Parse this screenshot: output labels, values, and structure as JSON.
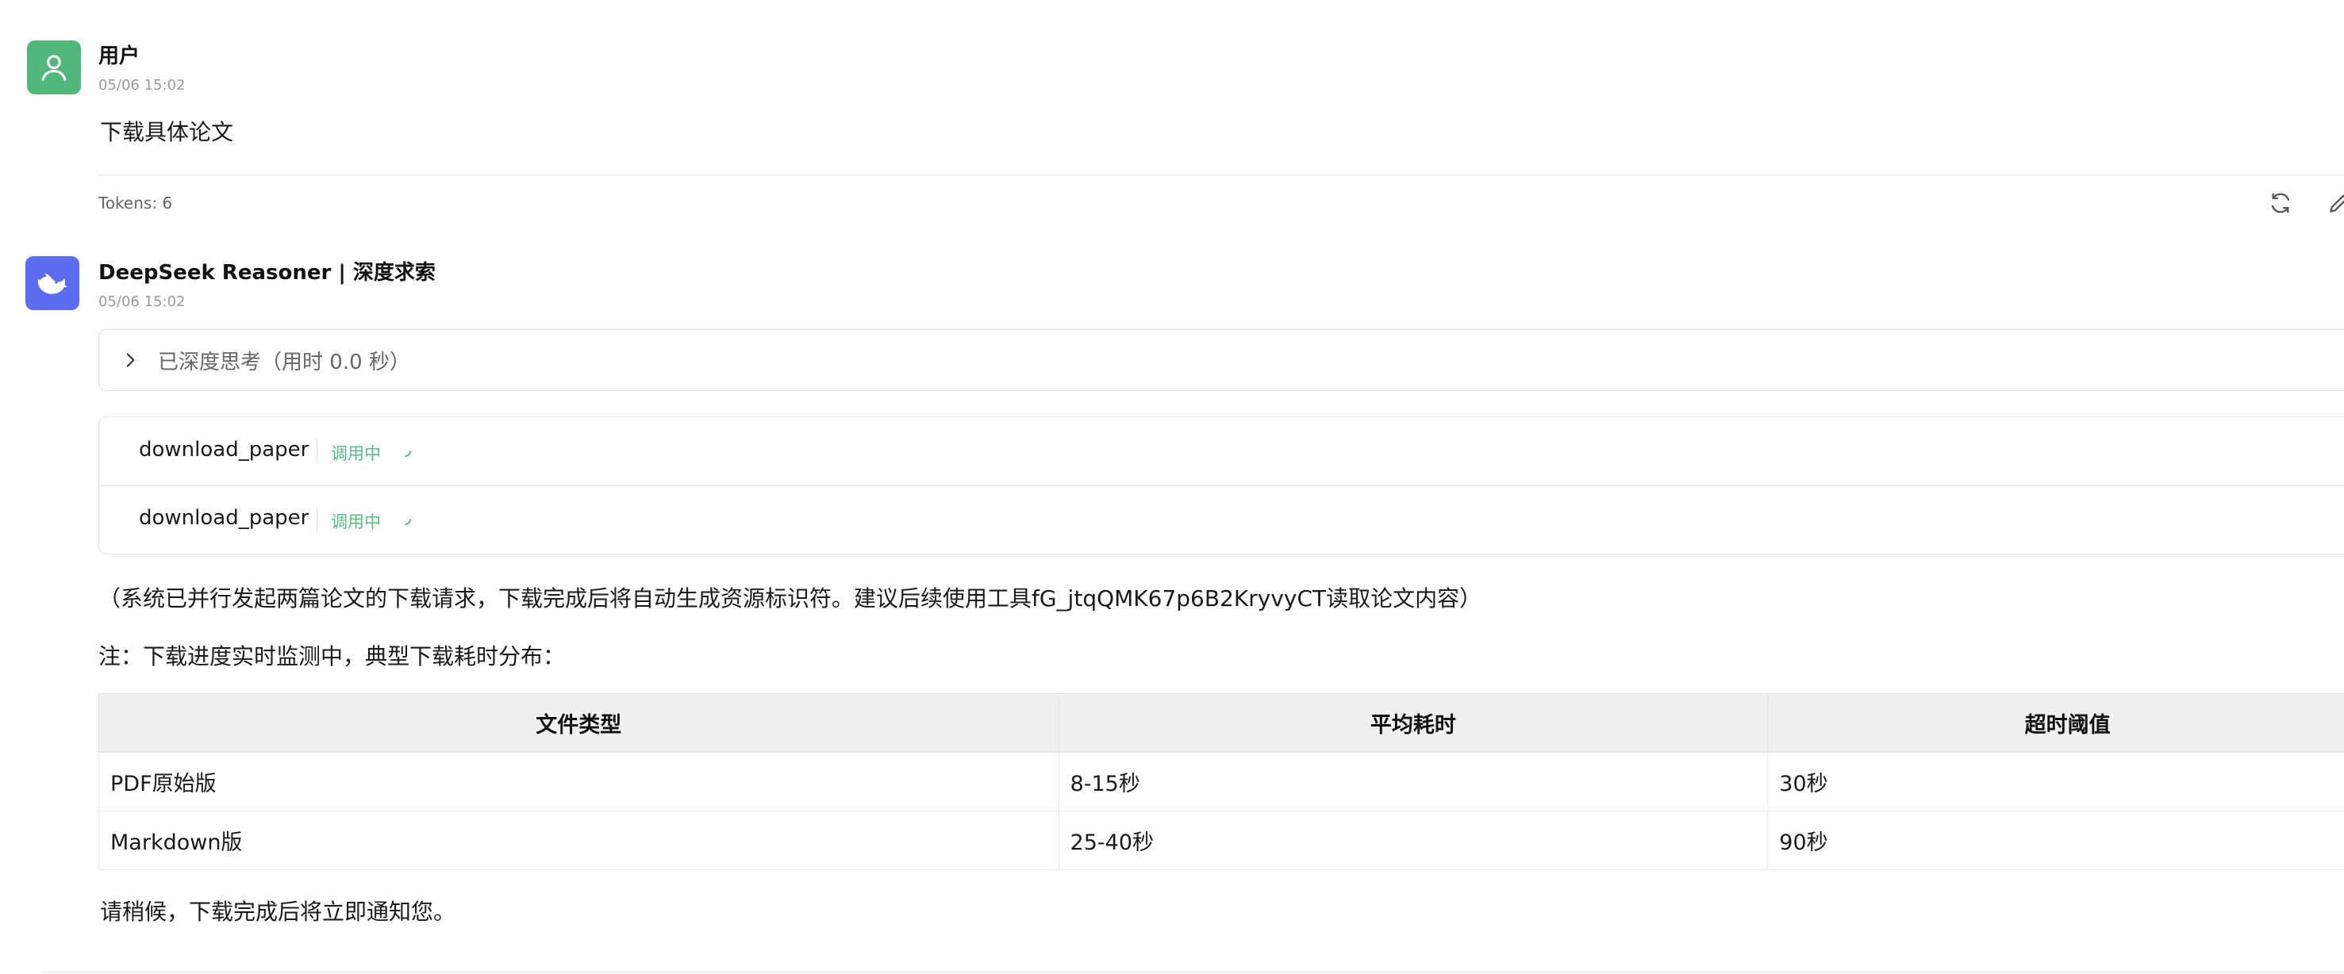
{
  "user_message": {
    "author": "用户",
    "timestamp": "05/06 15:02",
    "text": "下载具体论文",
    "tokens": "Tokens: 6"
  },
  "bot_message": {
    "author": "DeepSeek Reasoner | 深度求索",
    "timestamp": "05/06 15:02",
    "thinking_label": "已深度思考（用时 0.0 秒）",
    "tool_calls": [
      {
        "name": "download_paper",
        "status": "调用中"
      },
      {
        "name": "download_paper",
        "status": "调用中"
      }
    ],
    "paragraph1": "（系统已并行发起两篇论文的下载请求，下载完成后将自动生成资源标识符。建议后续使用工具fG_jtqQMK67p6B2KryvyCT读取论文内容）",
    "paragraph2": "注：下载进度实时监测中，典型下载耗时分布：",
    "table": {
      "headers": [
        "文件类型",
        "平均耗时",
        "超时阈值"
      ],
      "rows": [
        [
          "PDF原始版",
          "8-15秒",
          "30秒"
        ],
        [
          "Markdown版",
          "25-40秒",
          "90秒"
        ]
      ]
    },
    "closing": "请稍候，下载完成后将立即通知您。"
  },
  "icons": {
    "user_avatar": "user-icon",
    "bot_avatar": "whale-icon",
    "regenerate": "refresh-icon",
    "edit": "edit-icon",
    "expand": "chevron-right-icon",
    "loading": "spinner-icon"
  },
  "colors": {
    "user_avatar_bg": "#52b77a",
    "bot_avatar_bg": "#5b6cf0",
    "status_green": "#5bb983"
  }
}
